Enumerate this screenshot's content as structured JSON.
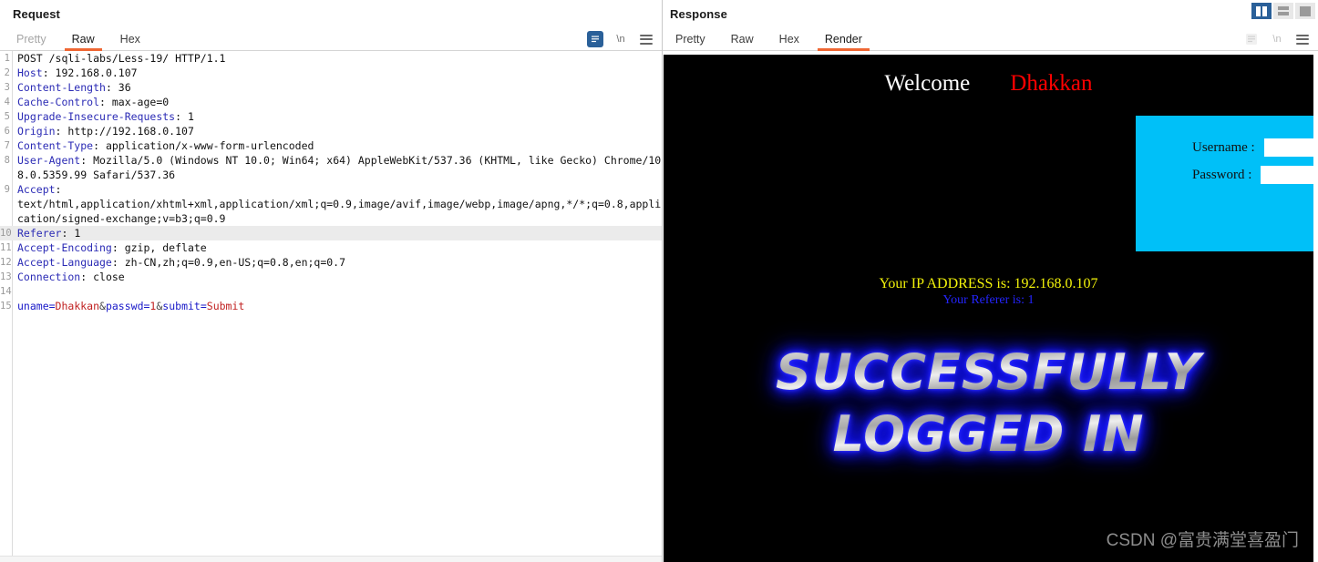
{
  "request": {
    "title": "Request",
    "tabs": [
      {
        "label": "Pretty",
        "active": false,
        "dim": true
      },
      {
        "label": "Raw",
        "active": true,
        "dim": false
      },
      {
        "label": "Hex",
        "active": false,
        "dim": false
      }
    ],
    "toolbar": {
      "pretty_print_icon": "word-wrap-icon",
      "newline_label": "\\n",
      "menu_icon": "hamburger-menu-icon"
    },
    "lines": [
      {
        "n": "1",
        "highlight": false,
        "parts": [
          {
            "t": "POST /sqli-labs/Less-19/ HTTP/1.1",
            "c": "hv"
          }
        ]
      },
      {
        "n": "2",
        "highlight": false,
        "parts": [
          {
            "t": "Host",
            "c": "hk"
          },
          {
            "t": ": 192.168.0.107",
            "c": "hv"
          }
        ]
      },
      {
        "n": "3",
        "highlight": false,
        "parts": [
          {
            "t": "Content-Length",
            "c": "hk"
          },
          {
            "t": ": 36",
            "c": "hv"
          }
        ]
      },
      {
        "n": "4",
        "highlight": false,
        "parts": [
          {
            "t": "Cache-Control",
            "c": "hk"
          },
          {
            "t": ": max-age=0",
            "c": "hv"
          }
        ]
      },
      {
        "n": "5",
        "highlight": false,
        "parts": [
          {
            "t": "Upgrade-Insecure-Requests",
            "c": "hk"
          },
          {
            "t": ": 1",
            "c": "hv"
          }
        ]
      },
      {
        "n": "6",
        "highlight": false,
        "parts": [
          {
            "t": "Origin",
            "c": "hk"
          },
          {
            "t": ": http://192.168.0.107",
            "c": "hv"
          }
        ]
      },
      {
        "n": "7",
        "highlight": false,
        "parts": [
          {
            "t": "Content-Type",
            "c": "hk"
          },
          {
            "t": ": application/x-www-form-urlencoded",
            "c": "hv"
          }
        ]
      },
      {
        "n": "8",
        "highlight": false,
        "parts": [
          {
            "t": "User-Agent",
            "c": "hk"
          },
          {
            "t": ": Mozilla/5.0 (Windows NT 10.0; Win64; x64) AppleWebKit/537.36 (KHTML, like Gecko) Chrome/108.0.5359.99 Safari/537.36",
            "c": "hv"
          }
        ]
      },
      {
        "n": "9",
        "highlight": false,
        "parts": [
          {
            "t": "Accept",
            "c": "hk"
          },
          {
            "t": ": \ntext/html,application/xhtml+xml,application/xml;q=0.9,image/avif,image/webp,image/apng,*/*;q=0.8,application/signed-exchange;v=b3;q=0.9",
            "c": "hv"
          }
        ]
      },
      {
        "n": "10",
        "highlight": true,
        "parts": [
          {
            "t": "Referer",
            "c": "hk"
          },
          {
            "t": ": 1",
            "c": "hv"
          }
        ]
      },
      {
        "n": "11",
        "highlight": false,
        "parts": [
          {
            "t": "Accept-Encoding",
            "c": "hk"
          },
          {
            "t": ": gzip, deflate",
            "c": "hv"
          }
        ]
      },
      {
        "n": "12",
        "highlight": false,
        "parts": [
          {
            "t": "Accept-Language",
            "c": "hk"
          },
          {
            "t": ": zh-CN,zh;q=0.9,en-US;q=0.8,en;q=0.7",
            "c": "hv"
          }
        ]
      },
      {
        "n": "13",
        "highlight": false,
        "parts": [
          {
            "t": "Connection",
            "c": "hk"
          },
          {
            "t": ": close",
            "c": "hv"
          }
        ]
      },
      {
        "n": "14",
        "highlight": false,
        "parts": [
          {
            "t": "",
            "c": "hv"
          }
        ]
      },
      {
        "n": "15",
        "highlight": false,
        "parts": [
          {
            "t": "uname=",
            "c": "pk"
          },
          {
            "t": "Dhakkan",
            "c": "pv"
          },
          {
            "t": "&",
            "c": "amp"
          },
          {
            "t": "passwd=",
            "c": "pk"
          },
          {
            "t": "1",
            "c": "pv"
          },
          {
            "t": "&",
            "c": "amp"
          },
          {
            "t": "submit=",
            "c": "pk"
          },
          {
            "t": "Submit",
            "c": "pv"
          }
        ]
      }
    ]
  },
  "response": {
    "title": "Response",
    "tabs": [
      {
        "label": "Pretty",
        "active": false,
        "dim": false
      },
      {
        "label": "Raw",
        "active": false,
        "dim": false
      },
      {
        "label": "Hex",
        "active": false,
        "dim": false
      },
      {
        "label": "Render",
        "active": true,
        "dim": false
      }
    ],
    "toolbar": {
      "pretty_print_icon": "word-wrap-icon",
      "newline_label": "\\n",
      "menu_icon": "hamburger-menu-icon"
    },
    "layout_buttons": [
      {
        "name": "split-vertical",
        "active": true
      },
      {
        "name": "split-horizontal",
        "active": false
      },
      {
        "name": "single-pane",
        "active": false
      }
    ],
    "render": {
      "welcome_text": "Welcome",
      "username_display": "Dhakkan",
      "login_form": {
        "username_label": "Username :",
        "password_label": "Password :",
        "username_value": "",
        "password_value": ""
      },
      "ip_line": "Your IP ADDRESS is: 192.168.0.107",
      "referer_line": "Your Referer is: 1",
      "success_line_1": "SUCCESSFULLY",
      "success_line_2": "LOGGED IN",
      "watermark": "CSDN @富贵满堂喜盈门",
      "colors": {
        "background": "#000000",
        "welcome": "#ffffff",
        "username": "#ff0000",
        "form_background": "#00c0f8",
        "ip_text": "#f2f20a",
        "referer_text": "#2424ff",
        "success_glow": "#1414ff",
        "watermark": "#8d8d8d"
      }
    }
  },
  "theme": {
    "tab_accent": "#ef6733",
    "toolbar_active": "#2a6099",
    "highlight_row": "#ebebeb"
  }
}
